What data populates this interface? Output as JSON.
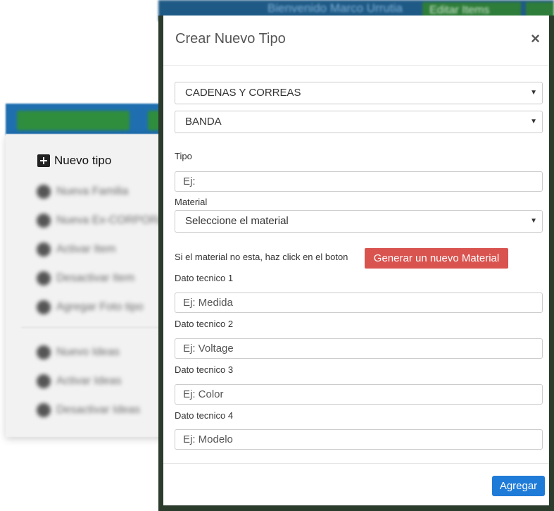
{
  "background": {
    "welcome_text": "Bienvenido Marco Urrutia",
    "edit_button_label": "Editar Items",
    "menu": {
      "new_type_label": "Nuevo tipo",
      "blurred_items": [
        "Nueva Familia",
        "Nueva Ex-CORPORA",
        "Activar Item",
        "Desactivar Item",
        "Agregar Foto tipo",
        "Nuevo Ideas",
        "Activar Ideas",
        "Desactivar Ideas"
      ]
    }
  },
  "modal": {
    "title": "Crear Nuevo Tipo",
    "close_symbol": "×",
    "category_select": "CADENAS Y CORREAS",
    "subcategory_select": "BANDA",
    "tipo_label": "Tipo",
    "tipo_placeholder": "Ej:",
    "material_label": "Material",
    "material_select": "Seleccione el material",
    "material_note": "Si el material no esta, haz click en el boton",
    "generate_material_button": "Generar un nuevo Material",
    "dato1_label": "Dato tecnico 1",
    "dato1_placeholder": "Ej: Medida",
    "dato2_label": "Dato tecnico 2",
    "dato2_placeholder": "Ej: Voltage",
    "dato3_label": "Dato tecnico 3",
    "dato3_placeholder": "Ej: Color",
    "dato4_label": "Dato tecnico 4",
    "dato4_placeholder": "Ej: Modelo",
    "submit_button": "Agregar"
  },
  "colors": {
    "primary": "#1f7bd8",
    "danger": "#d9534f",
    "header_bar": "#1f5a86"
  }
}
